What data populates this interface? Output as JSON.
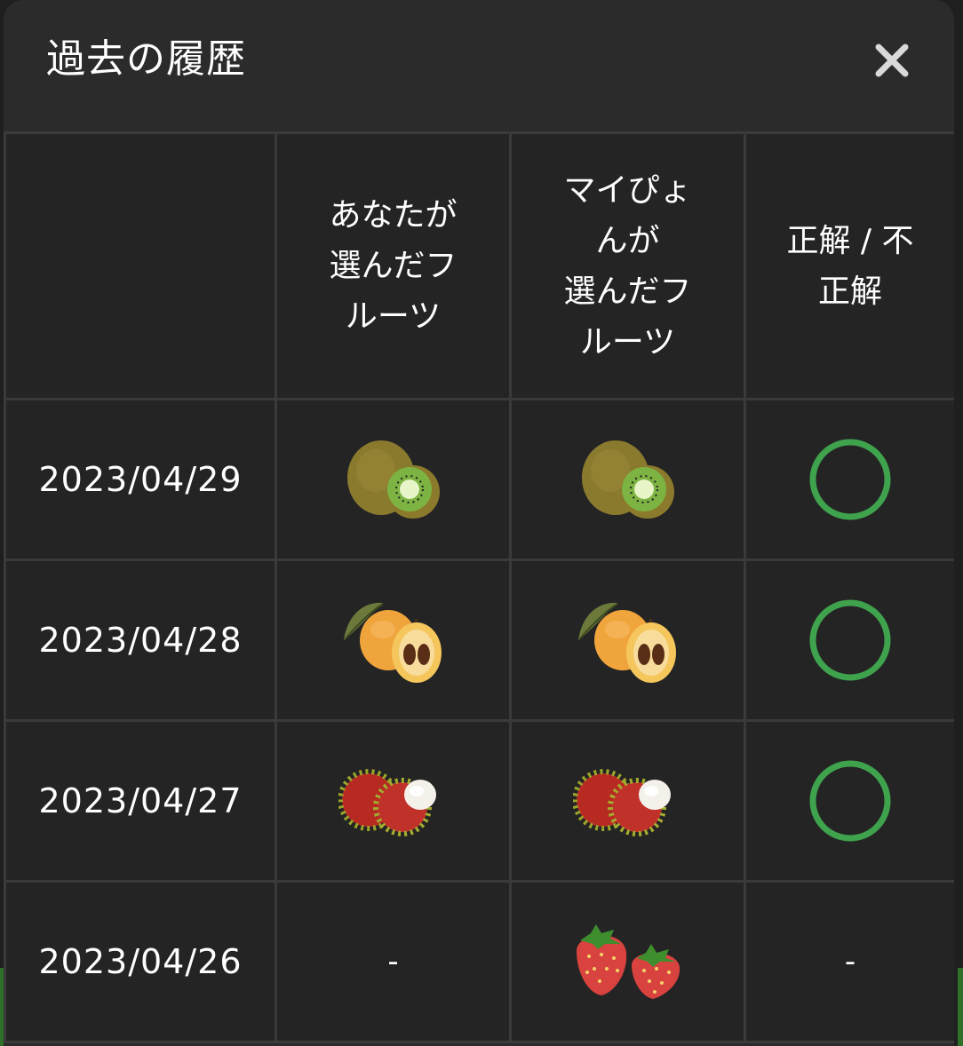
{
  "modal": {
    "title": "過去の履歴",
    "close_icon": "close-icon"
  },
  "table": {
    "headers": {
      "date": "",
      "you": "あなたが\n選んだフ\nルーツ",
      "mine": "マイぴょ\nんが\n選んだフ\nルーツ",
      "result": "正解 / 不\n正解"
    },
    "rows": [
      {
        "date": "2023/04/29",
        "you_fruit": "kiwi-icon",
        "mine_fruit": "kiwi-icon",
        "result": "correct-circle-icon"
      },
      {
        "date": "2023/04/28",
        "you_fruit": "loquat-icon",
        "mine_fruit": "loquat-icon",
        "result": "correct-circle-icon"
      },
      {
        "date": "2023/04/27",
        "you_fruit": "rambutan-icon",
        "mine_fruit": "rambutan-icon",
        "result": "correct-circle-icon"
      },
      {
        "date": "2023/04/26",
        "you_fruit": "-",
        "mine_fruit": "strawberry-icon",
        "result": "-"
      }
    ]
  },
  "colors": {
    "modal_bg": "#2b2b2b",
    "cell_bg": "#242424",
    "grid_line": "#3a3a3a",
    "correct_green": "#3fa34d",
    "text": "#ffffff"
  }
}
